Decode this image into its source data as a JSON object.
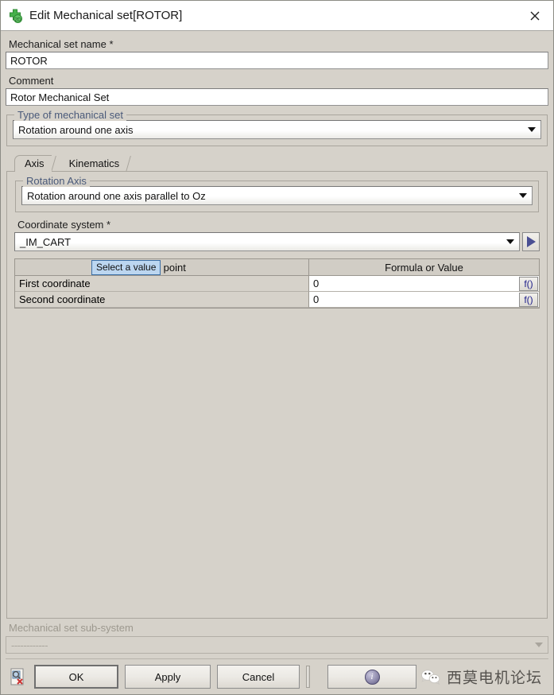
{
  "window": {
    "title": "Edit Mechanical set[ROTOR]",
    "icon": "mechanical-set-2d-icon",
    "close_icon": "close-icon"
  },
  "form": {
    "name_label": "Mechanical set name *",
    "name_value": "ROTOR",
    "comment_label": "Comment",
    "comment_value": "Rotor Mechanical Set",
    "type_group_title": "Type of mechanical set",
    "type_value": "Rotation around one axis"
  },
  "tabs": [
    {
      "label": "Axis",
      "active": true
    },
    {
      "label": "Kinematics",
      "active": false
    }
  ],
  "axis_tab": {
    "rotation_group_title": "Rotation Axis",
    "rotation_value": "Rotation around one axis parallel to Oz",
    "coordinate_label": "Coordinate system *",
    "coordinate_value": "_IM_CART",
    "goto_icon": "play-arrow-icon",
    "table": {
      "headers": [
        "Pivot point",
        "Formula or Value"
      ],
      "rows": [
        {
          "label": "First coordinate",
          "value": "0",
          "formula_button": "f()"
        },
        {
          "label": "Second coordinate",
          "value": "0",
          "formula_button": "f()"
        }
      ]
    },
    "tooltip": "Select a value"
  },
  "bottom": {
    "subsystem_label": "Mechanical set sub-system",
    "subsystem_value": "------------",
    "buttons": {
      "preview": "preview-document-icon",
      "ok": "OK",
      "apply": "Apply",
      "cancel": "Cancel",
      "info": "i"
    },
    "watermark": "西莫电机论坛"
  },
  "colors": {
    "dialog_bg": "#d6d2ca",
    "titlebar_bg": "#ffffff",
    "group_title": "#4a5a7a",
    "tooltip_bg": "#bcd6f0",
    "tooltip_border": "#3b6ea5",
    "accent_arrow": "#4a4f93",
    "disabled_text": "#a9a59d"
  }
}
